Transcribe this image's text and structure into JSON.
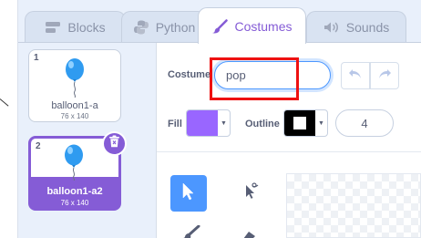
{
  "tabs": [
    {
      "label": "Blocks",
      "icon": "blocks-icon",
      "active": false
    },
    {
      "label": "Python",
      "icon": "python-icon",
      "active": false
    },
    {
      "label": "Costumes",
      "icon": "paintbrush-icon",
      "active": true
    },
    {
      "label": "Sounds",
      "icon": "speaker-icon",
      "active": false
    }
  ],
  "costumes": [
    {
      "number": "1",
      "name": "balloon1-a",
      "size": "76 x 140",
      "selected": false
    },
    {
      "number": "2",
      "name": "balloon1-a2",
      "size": "76 x 140",
      "selected": true
    }
  ],
  "editor": {
    "costume_label": "Costume",
    "costume_name": "pop",
    "fill_label": "Fill",
    "fill_color": "#9966ff",
    "outline_label": "Outline",
    "outline_color": "#000000",
    "outline_width": "4"
  },
  "colors": {
    "accent": "#855cd6",
    "tool_active": "#4c97ff",
    "annotation_red": "#ee1111",
    "balloon_blue": "#2f9bf0"
  }
}
